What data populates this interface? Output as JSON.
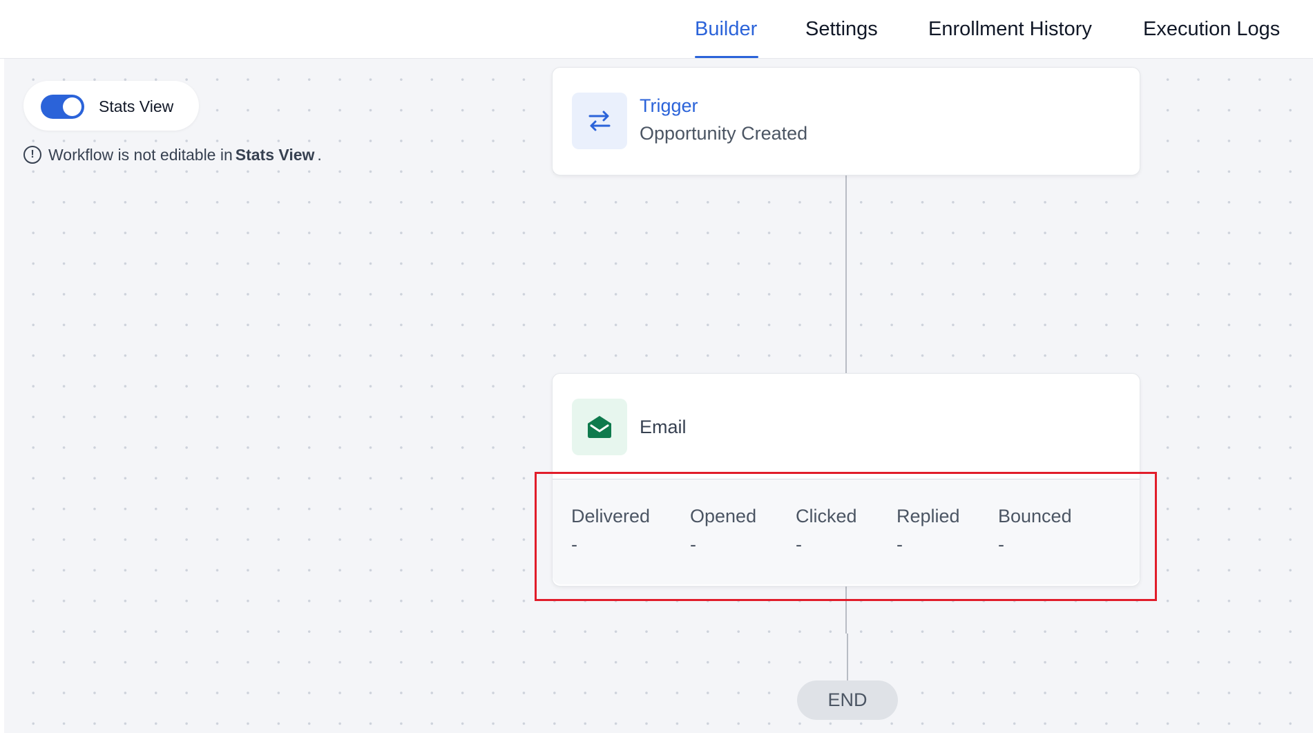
{
  "tabs": [
    {
      "label": "Builder",
      "active": true
    },
    {
      "label": "Settings",
      "active": false
    },
    {
      "label": "Enrollment History",
      "active": false
    },
    {
      "label": "Execution Logs",
      "active": false
    }
  ],
  "stats_view": {
    "label": "Stats View",
    "enabled": true
  },
  "note": {
    "prefix": "Workflow is not editable in",
    "bold": "Stats View",
    "suffix": "."
  },
  "trigger_node": {
    "title": "Trigger",
    "subtitle": "Opportunity Created",
    "icon": "arrows-swap-icon"
  },
  "email_node": {
    "title": "Email",
    "icon": "envelope-open-icon",
    "stats": [
      {
        "label": "Delivered",
        "value": "-"
      },
      {
        "label": "Opened",
        "value": "-"
      },
      {
        "label": "Clicked",
        "value": "-"
      },
      {
        "label": "Replied",
        "value": "-"
      },
      {
        "label": "Bounced",
        "value": "-"
      }
    ]
  },
  "end_node": {
    "label": "END"
  },
  "colors": {
    "accent": "#2b63d9",
    "highlight": "#e11d2a",
    "email_icon": "#0f7a4d",
    "canvas": "#f4f5f8"
  }
}
